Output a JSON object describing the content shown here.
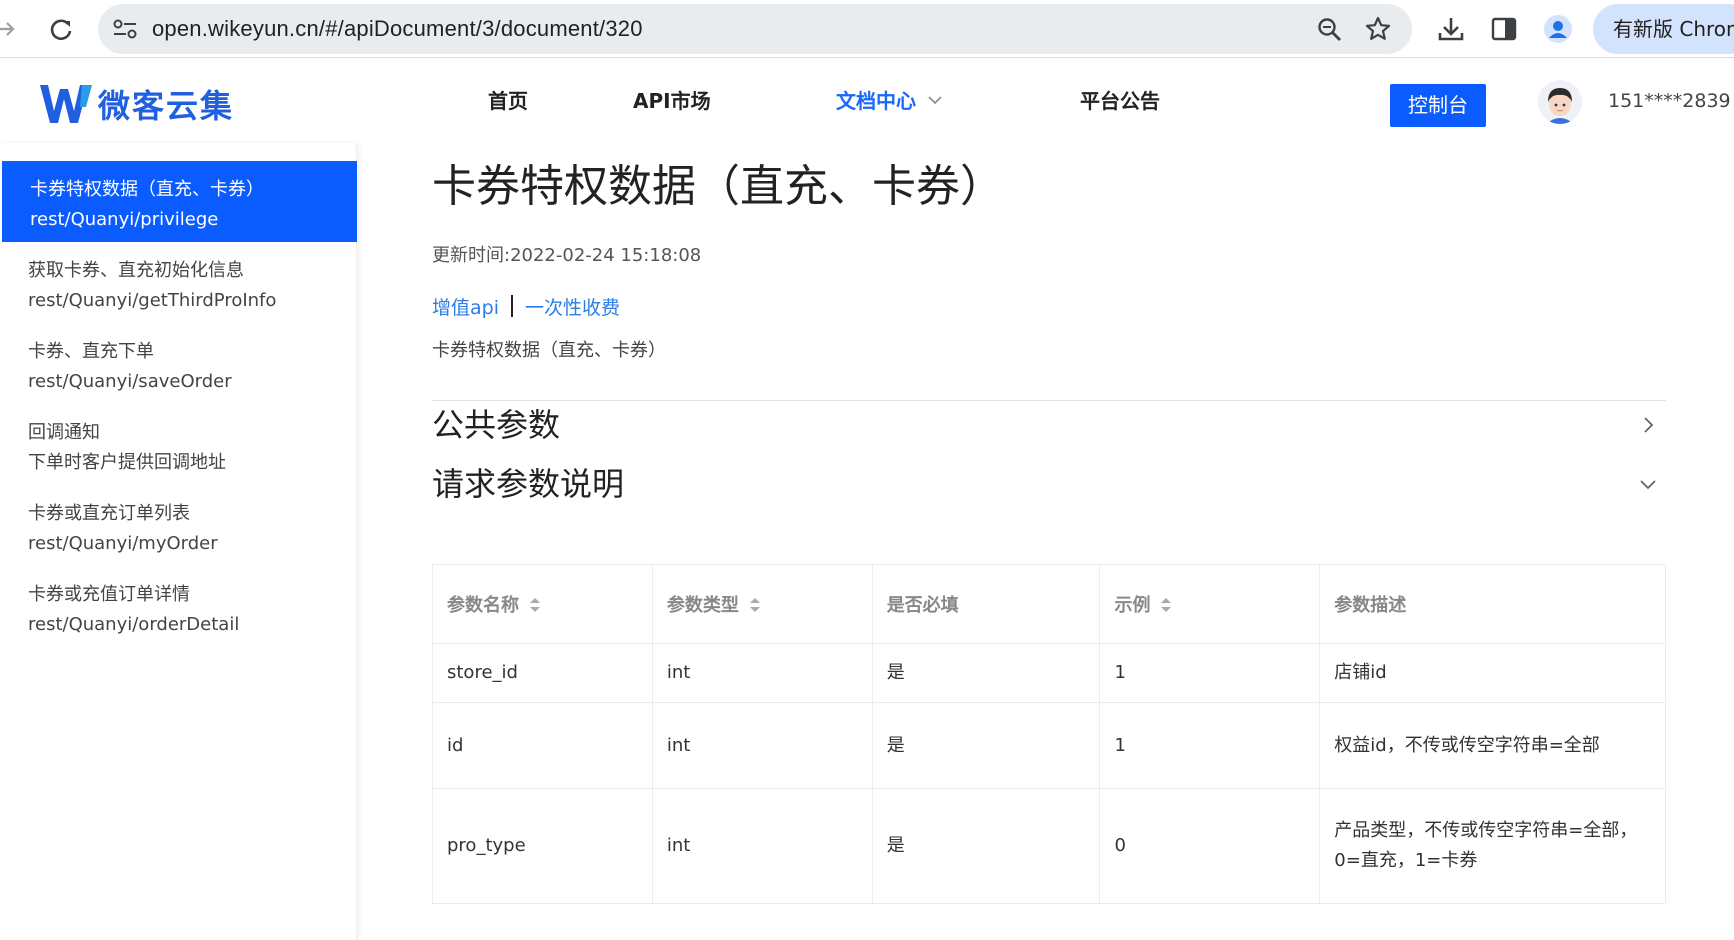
{
  "browser": {
    "url": "open.wikeyun.cn/#/apiDocument/3/document/320",
    "update_label": "有新版 Chrome",
    "icons": [
      "forward-icon",
      "reload-icon",
      "site-settings-icon",
      "zoom-icon",
      "bookmark-star-icon",
      "download-icon",
      "side-panel-icon",
      "profile-icon"
    ]
  },
  "header": {
    "brand": "微客云集",
    "nav": [
      {
        "label": "首页"
      },
      {
        "label": "API市场"
      },
      {
        "label": "文档中心",
        "active": true
      },
      {
        "label": "平台公告"
      }
    ],
    "console_button": "控制台",
    "user_phone": "151****2839",
    "accent_color": "#0b5cff"
  },
  "sidebar": {
    "items": [
      {
        "title": "卡券特权数据（直充、卡券）",
        "subtitle": "rest/Quanyi/privilege",
        "active": true
      },
      {
        "title": "获取卡券、直充初始化信息",
        "subtitle": "rest/Quanyi/getThirdProInfo"
      },
      {
        "title": "卡券、直充下单",
        "subtitle": "rest/Quanyi/saveOrder"
      },
      {
        "title": "回调通知",
        "subtitle": "下单时客户提供回调地址"
      },
      {
        "title": "卡券或直充订单列表",
        "subtitle": "rest/Quanyi/myOrder"
      },
      {
        "title": "卡券或充值订单详情",
        "subtitle": "rest/Quanyi/orderDetail"
      }
    ]
  },
  "doc": {
    "title": "卡券特权数据（直充、卡券）",
    "update_time": "更新时间:2022-02-24 15:18:08",
    "tags": [
      "增值api",
      "一次性收费"
    ],
    "description": "卡券特权数据（直充、卡券）",
    "sections": {
      "public_params": "公共参数",
      "request_params": "请求参数说明"
    },
    "table": {
      "headers": [
        "参数名称",
        "参数类型",
        "是否必填",
        "示例",
        "参数描述"
      ],
      "rows": [
        [
          "store_id",
          "int",
          "是",
          "1",
          "店铺id"
        ],
        [
          "id",
          "int",
          "是",
          "1",
          "权益id，不传或传空字符串=全部"
        ],
        [
          "pro_type",
          "int",
          "是",
          "0",
          "产品类型，不传或传空字符串=全部，0=直充，1=卡券"
        ]
      ]
    }
  }
}
